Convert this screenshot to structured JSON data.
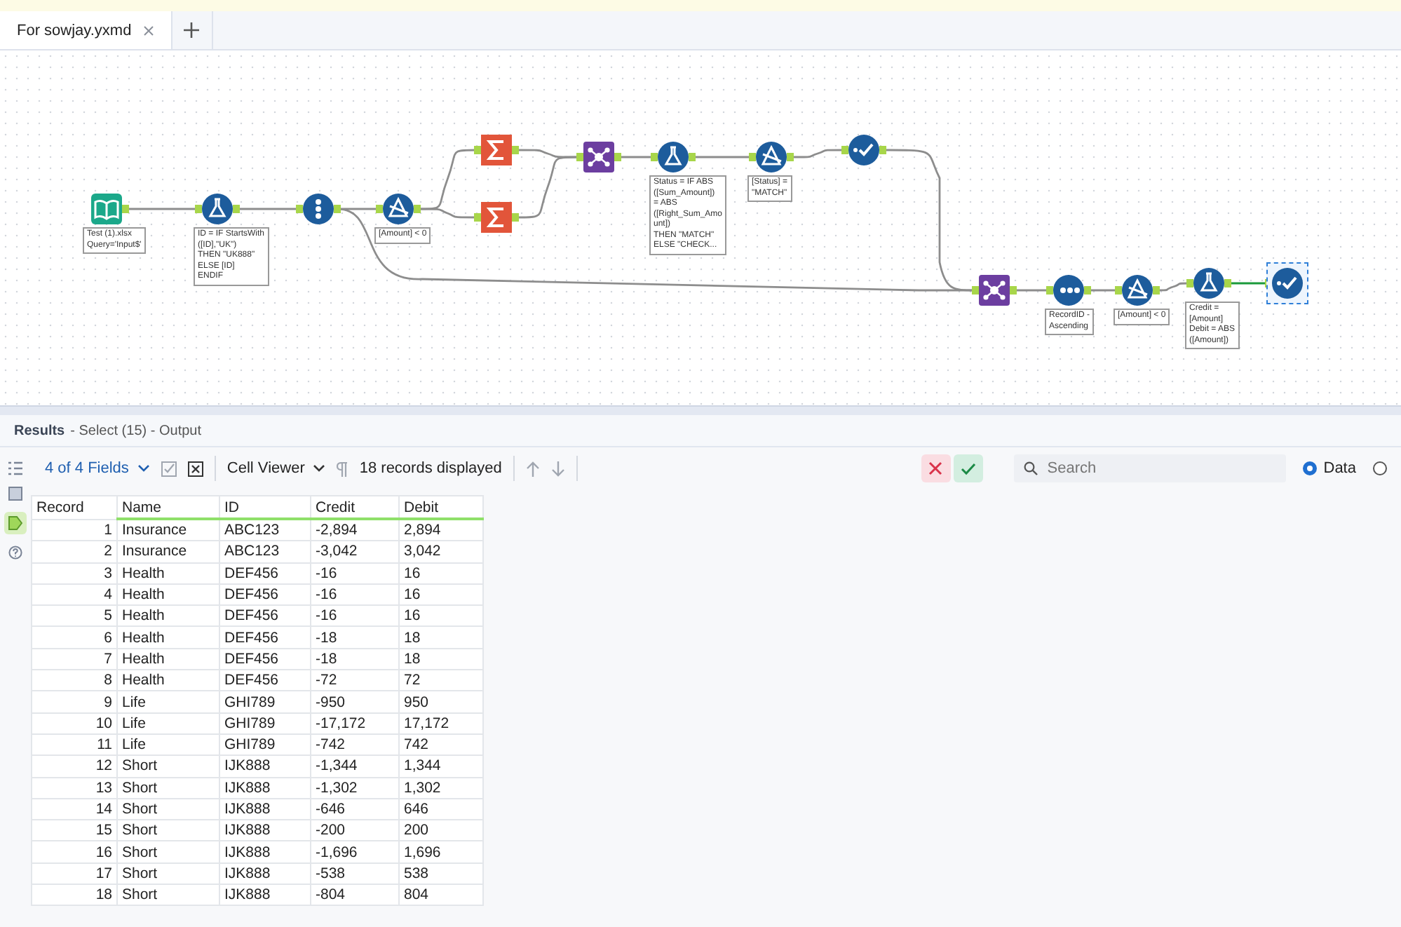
{
  "tab": {
    "title": "For sowjay.yxmd",
    "selected": true
  },
  "nodes": [
    {
      "kind": "input",
      "selected": false,
      "annotation": [
        "Test (1).xlsx",
        "Query='Input$'"
      ]
    },
    {
      "kind": "formula",
      "selected": false,
      "annotation": [
        "ID = IF StartsWith",
        "([ID],\"UK\")",
        "THEN \"UK888\"",
        "ELSE [ID]",
        "ENDIF"
      ]
    },
    {
      "kind": "select",
      "selected": false
    },
    {
      "kind": "filter",
      "selected": false,
      "annotation": [
        "[Amount]  < 0"
      ]
    },
    {
      "kind": "summarize",
      "selected": false
    },
    {
      "kind": "summarize",
      "selected": false
    },
    {
      "kind": "join",
      "selected": false
    },
    {
      "kind": "formula",
      "selected": false,
      "annotation": [
        "Status = IF ABS",
        "([Sum_Amount])",
        "= ABS",
        "([Right_Sum_Amo",
        "unt])",
        "THEN \"MATCH\"",
        "ELSE \"CHECK..."
      ]
    },
    {
      "kind": "filter",
      "selected": false,
      "annotation": [
        "[Status] =",
        "\"MATCH\""
      ]
    },
    {
      "kind": "check",
      "selected": false
    },
    {
      "kind": "join",
      "selected": false
    },
    {
      "kind": "recordid",
      "selected": false,
      "annotation": [
        "RecordID -",
        "Ascending"
      ]
    },
    {
      "kind": "filter",
      "selected": false,
      "annotation": [
        "[Amount]  < 0"
      ]
    },
    {
      "kind": "formula",
      "selected": false,
      "annotation": [
        "Credit =",
        "[Amount]",
        "Debit = ABS",
        "([Amount])"
      ]
    },
    {
      "kind": "check",
      "selected": true
    }
  ],
  "results": {
    "title": "Results",
    "subtitle": "- Select (15) - Output"
  },
  "toolbar": {
    "fields": "4 of 4 Fields",
    "viewer": "Cell Viewer",
    "records": "18 records displayed",
    "search_placeholder": "Search",
    "view_options": [
      {
        "label": "Data",
        "selected": true
      },
      {
        "selected": false
      }
    ]
  },
  "table": {
    "columns": [
      "Record",
      "Name",
      "ID",
      "Credit",
      "Debit"
    ],
    "rows": [
      [
        "1",
        "Insurance",
        "ABC123",
        "-2,894",
        "2,894"
      ],
      [
        "2",
        "Insurance",
        "ABC123",
        "-3,042",
        "3,042"
      ],
      [
        "3",
        "Health",
        "DEF456",
        "-16",
        "16"
      ],
      [
        "4",
        "Health",
        "DEF456",
        "-16",
        "16"
      ],
      [
        "5",
        "Health",
        "DEF456",
        "-16",
        "16"
      ],
      [
        "6",
        "Health",
        "DEF456",
        "-18",
        "18"
      ],
      [
        "7",
        "Health",
        "DEF456",
        "-18",
        "18"
      ],
      [
        "8",
        "Health",
        "DEF456",
        "-72",
        "72"
      ],
      [
        "9",
        "Life",
        "GHI789",
        "-950",
        "950"
      ],
      [
        "10",
        "Life",
        "GHI789",
        "-17,172",
        "17,172"
      ],
      [
        "11",
        "Life",
        "GHI789",
        "-742",
        "742"
      ],
      [
        "12",
        "Short",
        "IJK888",
        "-1,344",
        "1,344"
      ],
      [
        "13",
        "Short",
        "IJK888",
        "-1,302",
        "1,302"
      ],
      [
        "14",
        "Short",
        "IJK888",
        "-646",
        "646"
      ],
      [
        "15",
        "Short",
        "IJK888",
        "-200",
        "200"
      ],
      [
        "16",
        "Short",
        "IJK888",
        "-1,696",
        "1,696"
      ],
      [
        "17",
        "Short",
        "IJK888",
        "-538",
        "538"
      ],
      [
        "18",
        "Short",
        "IJK888",
        "-804",
        "804"
      ]
    ]
  }
}
